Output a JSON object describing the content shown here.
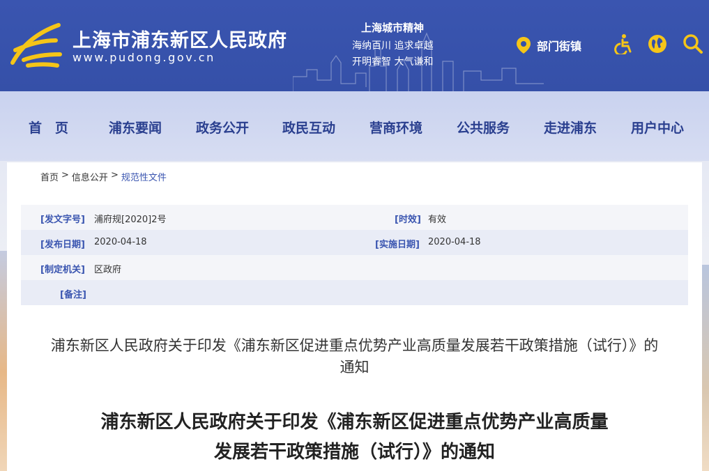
{
  "header": {
    "site_title": "上海市浦东新区人民政府",
    "site_url": "www.pudong.gov.cn",
    "spirit_title": "上海城市精神",
    "spirit_line1": "海纳百川  追求卓越",
    "spirit_line2": "开明睿智  大气谦和",
    "dept_label": "部门街镇",
    "icons": [
      "location-pin-icon",
      "accessibility-icon",
      "globe-icon",
      "search-icon"
    ],
    "accent": "#3a55b0",
    "logo_color": "#f5c518"
  },
  "nav": {
    "items": [
      "首　页",
      "浦东要闻",
      "政务公开",
      "政民互动",
      "营商环境",
      "公共服务",
      "走进浦东",
      "用户中心"
    ]
  },
  "breadcrumb": {
    "home": "首页",
    "sep1": ">",
    "level2": "信息公开",
    "sep2": ">",
    "current": "规范性文件"
  },
  "meta": {
    "doc_no_label": "[发文字号]",
    "doc_no": "浦府规[2020]2号",
    "validity_label": "[时效]",
    "validity": "有效",
    "publish_label": "[发布日期]",
    "publish_date": "2020-04-18",
    "effective_label": "[实施日期]",
    "effective_date": "2020-04-18",
    "issuer_label": "[制定机关]",
    "issuer": "区政府",
    "remark_label": "[备注]"
  },
  "document": {
    "title": "浦东新区人民政府关于印发《浦东新区促进重点优势产业高质量发展若干政策措施（试行）》的通知",
    "heading_line1": "浦东新区人民政府关于印发《浦东新区促进重点优势产业高质量",
    "heading_line2": "发展若干政策措施（试行）》的通知"
  }
}
